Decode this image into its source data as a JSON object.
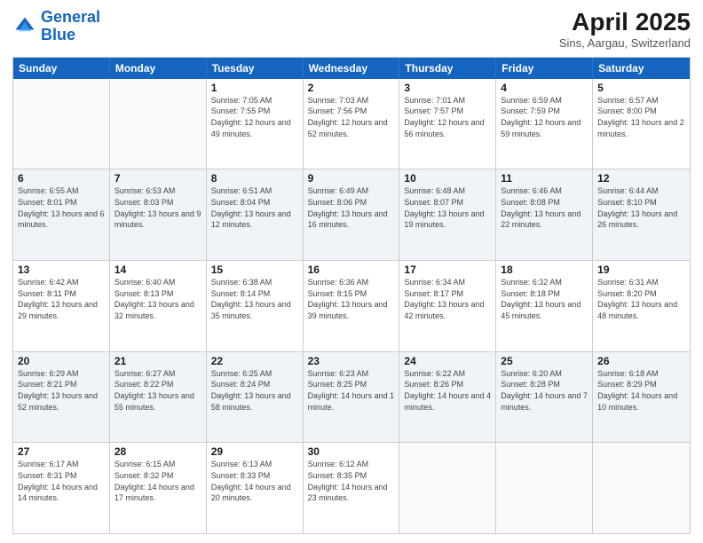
{
  "logo": {
    "line1": "General",
    "line2": "Blue"
  },
  "title": "April 2025",
  "subtitle": "Sins, Aargau, Switzerland",
  "weekdays": [
    "Sunday",
    "Monday",
    "Tuesday",
    "Wednesday",
    "Thursday",
    "Friday",
    "Saturday"
  ],
  "weeks": [
    [
      {
        "day": "",
        "sunrise": "",
        "sunset": "",
        "daylight": "",
        "empty": true
      },
      {
        "day": "",
        "sunrise": "",
        "sunset": "",
        "daylight": "",
        "empty": true
      },
      {
        "day": "1",
        "sunrise": "Sunrise: 7:05 AM",
        "sunset": "Sunset: 7:55 PM",
        "daylight": "Daylight: 12 hours and 49 minutes."
      },
      {
        "day": "2",
        "sunrise": "Sunrise: 7:03 AM",
        "sunset": "Sunset: 7:56 PM",
        "daylight": "Daylight: 12 hours and 52 minutes."
      },
      {
        "day": "3",
        "sunrise": "Sunrise: 7:01 AM",
        "sunset": "Sunset: 7:57 PM",
        "daylight": "Daylight: 12 hours and 56 minutes."
      },
      {
        "day": "4",
        "sunrise": "Sunrise: 6:59 AM",
        "sunset": "Sunset: 7:59 PM",
        "daylight": "Daylight: 12 hours and 59 minutes."
      },
      {
        "day": "5",
        "sunrise": "Sunrise: 6:57 AM",
        "sunset": "Sunset: 8:00 PM",
        "daylight": "Daylight: 13 hours and 2 minutes."
      }
    ],
    [
      {
        "day": "6",
        "sunrise": "Sunrise: 6:55 AM",
        "sunset": "Sunset: 8:01 PM",
        "daylight": "Daylight: 13 hours and 6 minutes."
      },
      {
        "day": "7",
        "sunrise": "Sunrise: 6:53 AM",
        "sunset": "Sunset: 8:03 PM",
        "daylight": "Daylight: 13 hours and 9 minutes."
      },
      {
        "day": "8",
        "sunrise": "Sunrise: 6:51 AM",
        "sunset": "Sunset: 8:04 PM",
        "daylight": "Daylight: 13 hours and 12 minutes."
      },
      {
        "day": "9",
        "sunrise": "Sunrise: 6:49 AM",
        "sunset": "Sunset: 8:06 PM",
        "daylight": "Daylight: 13 hours and 16 minutes."
      },
      {
        "day": "10",
        "sunrise": "Sunrise: 6:48 AM",
        "sunset": "Sunset: 8:07 PM",
        "daylight": "Daylight: 13 hours and 19 minutes."
      },
      {
        "day": "11",
        "sunrise": "Sunrise: 6:46 AM",
        "sunset": "Sunset: 8:08 PM",
        "daylight": "Daylight: 13 hours and 22 minutes."
      },
      {
        "day": "12",
        "sunrise": "Sunrise: 6:44 AM",
        "sunset": "Sunset: 8:10 PM",
        "daylight": "Daylight: 13 hours and 26 minutes."
      }
    ],
    [
      {
        "day": "13",
        "sunrise": "Sunrise: 6:42 AM",
        "sunset": "Sunset: 8:11 PM",
        "daylight": "Daylight: 13 hours and 29 minutes."
      },
      {
        "day": "14",
        "sunrise": "Sunrise: 6:40 AM",
        "sunset": "Sunset: 8:13 PM",
        "daylight": "Daylight: 13 hours and 32 minutes."
      },
      {
        "day": "15",
        "sunrise": "Sunrise: 6:38 AM",
        "sunset": "Sunset: 8:14 PM",
        "daylight": "Daylight: 13 hours and 35 minutes."
      },
      {
        "day": "16",
        "sunrise": "Sunrise: 6:36 AM",
        "sunset": "Sunset: 8:15 PM",
        "daylight": "Daylight: 13 hours and 39 minutes."
      },
      {
        "day": "17",
        "sunrise": "Sunrise: 6:34 AM",
        "sunset": "Sunset: 8:17 PM",
        "daylight": "Daylight: 13 hours and 42 minutes."
      },
      {
        "day": "18",
        "sunrise": "Sunrise: 6:32 AM",
        "sunset": "Sunset: 8:18 PM",
        "daylight": "Daylight: 13 hours and 45 minutes."
      },
      {
        "day": "19",
        "sunrise": "Sunrise: 6:31 AM",
        "sunset": "Sunset: 8:20 PM",
        "daylight": "Daylight: 13 hours and 48 minutes."
      }
    ],
    [
      {
        "day": "20",
        "sunrise": "Sunrise: 6:29 AM",
        "sunset": "Sunset: 8:21 PM",
        "daylight": "Daylight: 13 hours and 52 minutes."
      },
      {
        "day": "21",
        "sunrise": "Sunrise: 6:27 AM",
        "sunset": "Sunset: 8:22 PM",
        "daylight": "Daylight: 13 hours and 55 minutes."
      },
      {
        "day": "22",
        "sunrise": "Sunrise: 6:25 AM",
        "sunset": "Sunset: 8:24 PM",
        "daylight": "Daylight: 13 hours and 58 minutes."
      },
      {
        "day": "23",
        "sunrise": "Sunrise: 6:23 AM",
        "sunset": "Sunset: 8:25 PM",
        "daylight": "Daylight: 14 hours and 1 minute."
      },
      {
        "day": "24",
        "sunrise": "Sunrise: 6:22 AM",
        "sunset": "Sunset: 8:26 PM",
        "daylight": "Daylight: 14 hours and 4 minutes."
      },
      {
        "day": "25",
        "sunrise": "Sunrise: 6:20 AM",
        "sunset": "Sunset: 8:28 PM",
        "daylight": "Daylight: 14 hours and 7 minutes."
      },
      {
        "day": "26",
        "sunrise": "Sunrise: 6:18 AM",
        "sunset": "Sunset: 8:29 PM",
        "daylight": "Daylight: 14 hours and 10 minutes."
      }
    ],
    [
      {
        "day": "27",
        "sunrise": "Sunrise: 6:17 AM",
        "sunset": "Sunset: 8:31 PM",
        "daylight": "Daylight: 14 hours and 14 minutes."
      },
      {
        "day": "28",
        "sunrise": "Sunrise: 6:15 AM",
        "sunset": "Sunset: 8:32 PM",
        "daylight": "Daylight: 14 hours and 17 minutes."
      },
      {
        "day": "29",
        "sunrise": "Sunrise: 6:13 AM",
        "sunset": "Sunset: 8:33 PM",
        "daylight": "Daylight: 14 hours and 20 minutes."
      },
      {
        "day": "30",
        "sunrise": "Sunrise: 6:12 AM",
        "sunset": "Sunset: 8:35 PM",
        "daylight": "Daylight: 14 hours and 23 minutes."
      },
      {
        "day": "",
        "sunrise": "",
        "sunset": "",
        "daylight": "",
        "empty": true
      },
      {
        "day": "",
        "sunrise": "",
        "sunset": "",
        "daylight": "",
        "empty": true
      },
      {
        "day": "",
        "sunrise": "",
        "sunset": "",
        "daylight": "",
        "empty": true
      }
    ]
  ]
}
